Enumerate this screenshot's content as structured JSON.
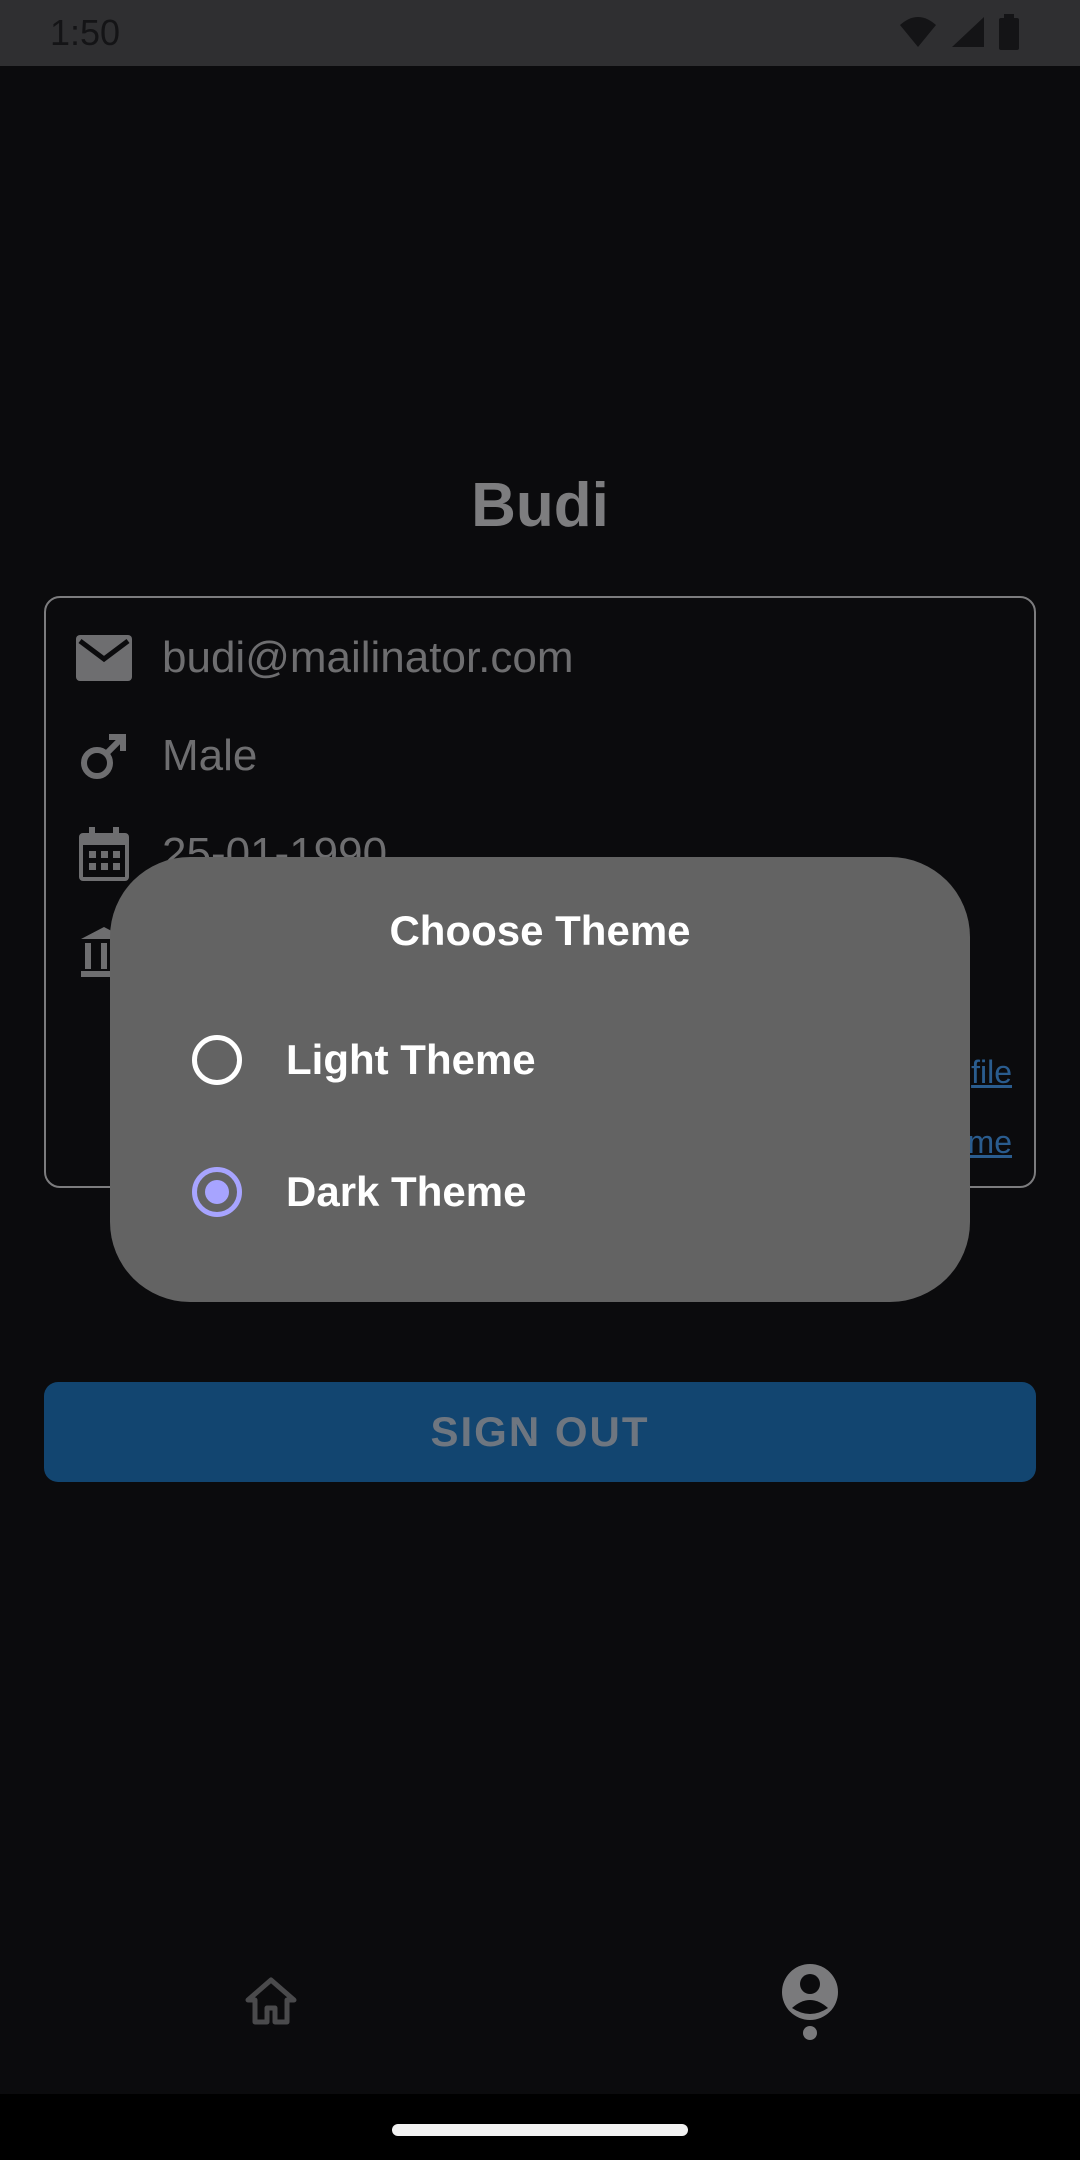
{
  "status_bar": {
    "time": "1:50"
  },
  "profile": {
    "name": "Budi",
    "email": "budi@mailinator.com",
    "gender": "Male",
    "birthdate": "25-01-1990",
    "link_edit_profile": "file",
    "link_change_theme": "me"
  },
  "actions": {
    "signout_label": "SIGN OUT"
  },
  "dialog": {
    "title": "Choose Theme",
    "options": [
      {
        "label": "Light Theme",
        "selected": false
      },
      {
        "label": "Dark Theme",
        "selected": true
      }
    ]
  },
  "nav": {
    "items": [
      "home-icon",
      "account-circle-icon"
    ],
    "active_index": 1
  },
  "colors": {
    "accent": "#a7a4ff",
    "button": "#124570",
    "dialog_bg": "#636363"
  }
}
